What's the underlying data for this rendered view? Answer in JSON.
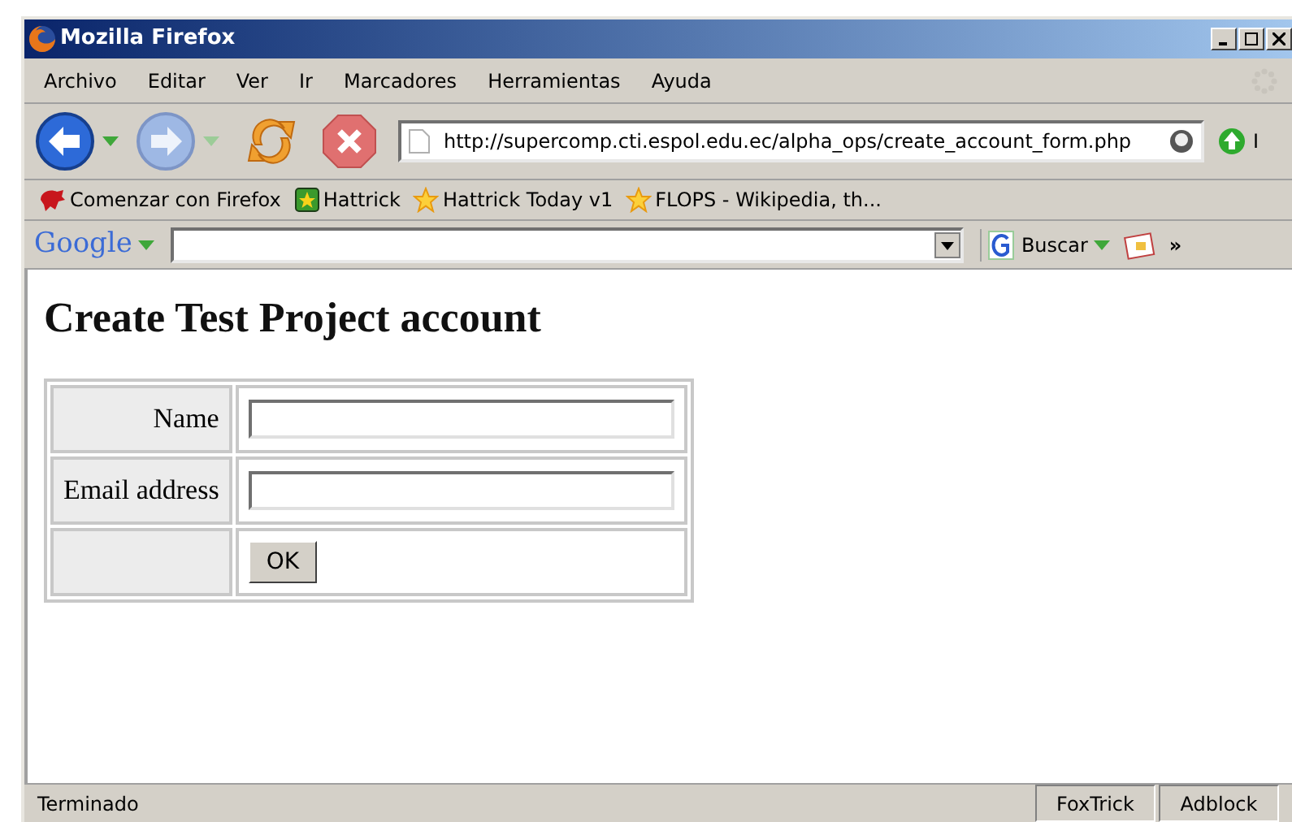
{
  "window": {
    "title": "Mozilla Firefox"
  },
  "menu": [
    "Archivo",
    "Editar",
    "Ver",
    "Ir",
    "Marcadores",
    "Herramientas",
    "Ayuda"
  ],
  "navigation": {
    "url": "http://supercomp.cti.espol.edu.ec/alpha_ops/create_account_form.php",
    "go_label": "I"
  },
  "bookmarks": [
    {
      "label": "Comenzar con Firefox",
      "kind": "dino"
    },
    {
      "label": "Hattrick",
      "kind": "square"
    },
    {
      "label": "Hattrick Today v1",
      "kind": "star"
    },
    {
      "label": "FLOPS - Wikipedia, th...",
      "kind": "star"
    }
  ],
  "google_bar": {
    "logo": "Google",
    "search_label": "Buscar",
    "more": "»"
  },
  "page": {
    "heading": "Create Test Project account",
    "form_rows": [
      {
        "label": "Name",
        "kind": "input"
      },
      {
        "label": "Email address",
        "kind": "input"
      },
      {
        "label": "",
        "kind": "button",
        "button_label": "OK"
      }
    ]
  },
  "status_bar": {
    "text": "Terminado",
    "panels": [
      "FoxTrick",
      "Adblock"
    ]
  }
}
